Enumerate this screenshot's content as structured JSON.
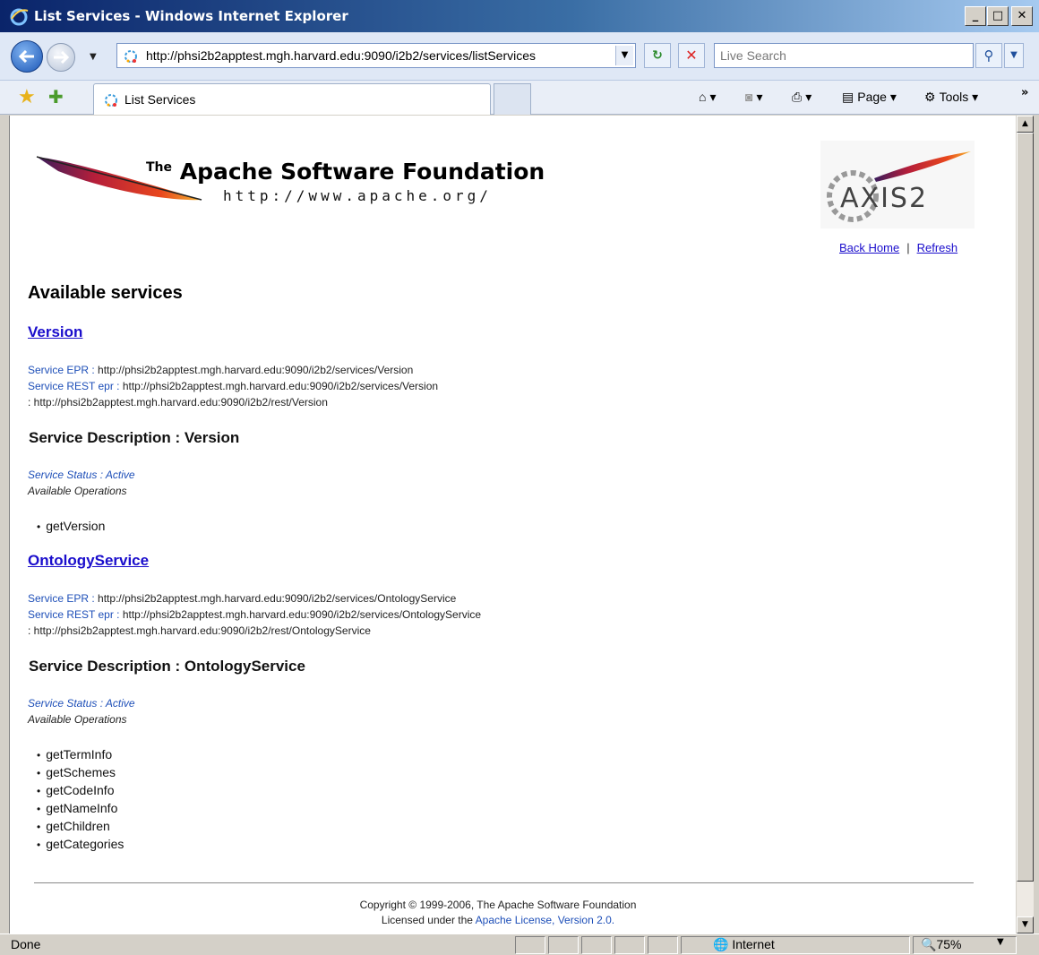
{
  "window": {
    "title": "List Services - Windows Internet Explorer"
  },
  "address_bar": {
    "url": "http://phsi2b2apptest.mgh.harvard.edu:9090/i2b2/services/listServices"
  },
  "search": {
    "placeholder": "Live Search"
  },
  "tab": {
    "label": "List Services"
  },
  "command_bar": {
    "page_label": "Page",
    "tools_label": "Tools"
  },
  "header": {
    "org_the": "The",
    "org_name": "Apache Software Foundation",
    "org_url": "http://www.apache.org/",
    "links": {
      "back_home": "Back Home",
      "separator": "|",
      "refresh": "Refresh"
    }
  },
  "main": {
    "heading": "Available services",
    "services": [
      {
        "name": "Version",
        "epr_label": "Service EPR :",
        "epr": "http://phsi2b2apptest.mgh.harvard.edu:9090/i2b2/services/Version",
        "rest_label": "Service REST epr :",
        "rest": "http://phsi2b2apptest.mgh.harvard.edu:9090/i2b2/services/Version",
        "rest2": ": http://phsi2b2apptest.mgh.harvard.edu:9090/i2b2/rest/Version",
        "description": "Service Description : Version",
        "status": "Service Status : Active",
        "ops_label": "Available Operations",
        "operations": [
          "getVersion"
        ]
      },
      {
        "name": "OntologyService",
        "epr_label": "Service EPR :",
        "epr": "http://phsi2b2apptest.mgh.harvard.edu:9090/i2b2/services/OntologyService",
        "rest_label": "Service REST epr :",
        "rest": "http://phsi2b2apptest.mgh.harvard.edu:9090/i2b2/services/OntologyService",
        "rest2": ": http://phsi2b2apptest.mgh.harvard.edu:9090/i2b2/rest/OntologyService",
        "description": "Service Description : OntologyService",
        "status": "Service Status : Active",
        "ops_label": "Available Operations",
        "operations": [
          "getTermInfo",
          "getSchemes",
          "getCodeInfo",
          "getNameInfo",
          "getChildren",
          "getCategories"
        ]
      }
    ]
  },
  "footer": {
    "copyright": "Copyright © 1999-2006, The Apache Software Foundation",
    "license_prefix": "Licensed under the",
    "license_link": "Apache License, Version 2.0."
  },
  "status_bar": {
    "status": "Done",
    "zone": "Internet",
    "zoom": "75%"
  },
  "icons": {
    "ie_logo": "ie-logo-icon",
    "back": "back-arrow-icon",
    "forward": "forward-arrow-icon",
    "refresh": "refresh-icon",
    "stop": "stop-icon",
    "search": "search-icon",
    "favorites": "favorites-star-icon",
    "add_favorite": "add-favorite-icon",
    "home": "home-icon",
    "feeds": "feeds-icon",
    "print": "print-icon",
    "page": "page-icon",
    "tools": "gear-icon",
    "globe": "globe-icon",
    "zoom": "zoom-icon"
  },
  "colors": {
    "link": "#1a0dcc",
    "accent_blue": "#1e4fb8",
    "titlebar": "#0a246a"
  }
}
